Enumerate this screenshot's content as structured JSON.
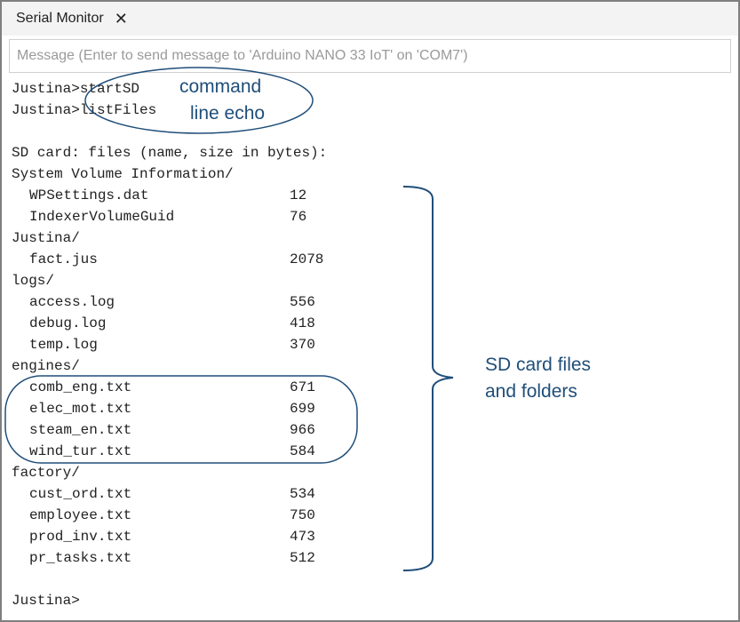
{
  "tab": {
    "title": "Serial Monitor",
    "close_icon": "close-icon"
  },
  "message_input": {
    "placeholder": "Message (Enter to send message to 'Arduino NANO 33 IoT' on 'COM7')",
    "value": ""
  },
  "console": {
    "commands": [
      {
        "prompt": "Justina>",
        "command": "startSD"
      },
      {
        "prompt": "Justina>",
        "command": "listFiles"
      }
    ],
    "header": "SD card: files (name, size in bytes):",
    "folders": [
      {
        "name": "System Volume Information/",
        "files": [
          {
            "name": "WPSettings.dat",
            "size": "12"
          },
          {
            "name": "IndexerVolumeGuid",
            "size": "76"
          }
        ]
      },
      {
        "name": "Justina/",
        "files": [
          {
            "name": "fact.jus",
            "size": "2078"
          }
        ]
      },
      {
        "name": "logs/",
        "files": [
          {
            "name": "access.log",
            "size": "556"
          },
          {
            "name": "debug.log",
            "size": "418"
          },
          {
            "name": "temp.log",
            "size": "370"
          }
        ]
      },
      {
        "name": "engines/",
        "files": [
          {
            "name": "comb_eng.txt",
            "size": "671"
          },
          {
            "name": "elec_mot.txt",
            "size": "699"
          },
          {
            "name": "steam_en.txt",
            "size": "966"
          },
          {
            "name": "wind_tur.txt",
            "size": "584"
          }
        ]
      },
      {
        "name": "factory/",
        "files": [
          {
            "name": "cust_ord.txt",
            "size": "534"
          },
          {
            "name": "employee.txt",
            "size": "750"
          },
          {
            "name": "prod_inv.txt",
            "size": "473"
          },
          {
            "name": "pr_tasks.txt",
            "size": "512"
          }
        ]
      }
    ],
    "final_prompt": "Justina>"
  },
  "annotations": {
    "command_echo": {
      "line1": "command",
      "line2": "line echo"
    },
    "sd_files": {
      "line1": "SD card files",
      "line2": "and folders"
    },
    "color": "#1f4e79"
  }
}
